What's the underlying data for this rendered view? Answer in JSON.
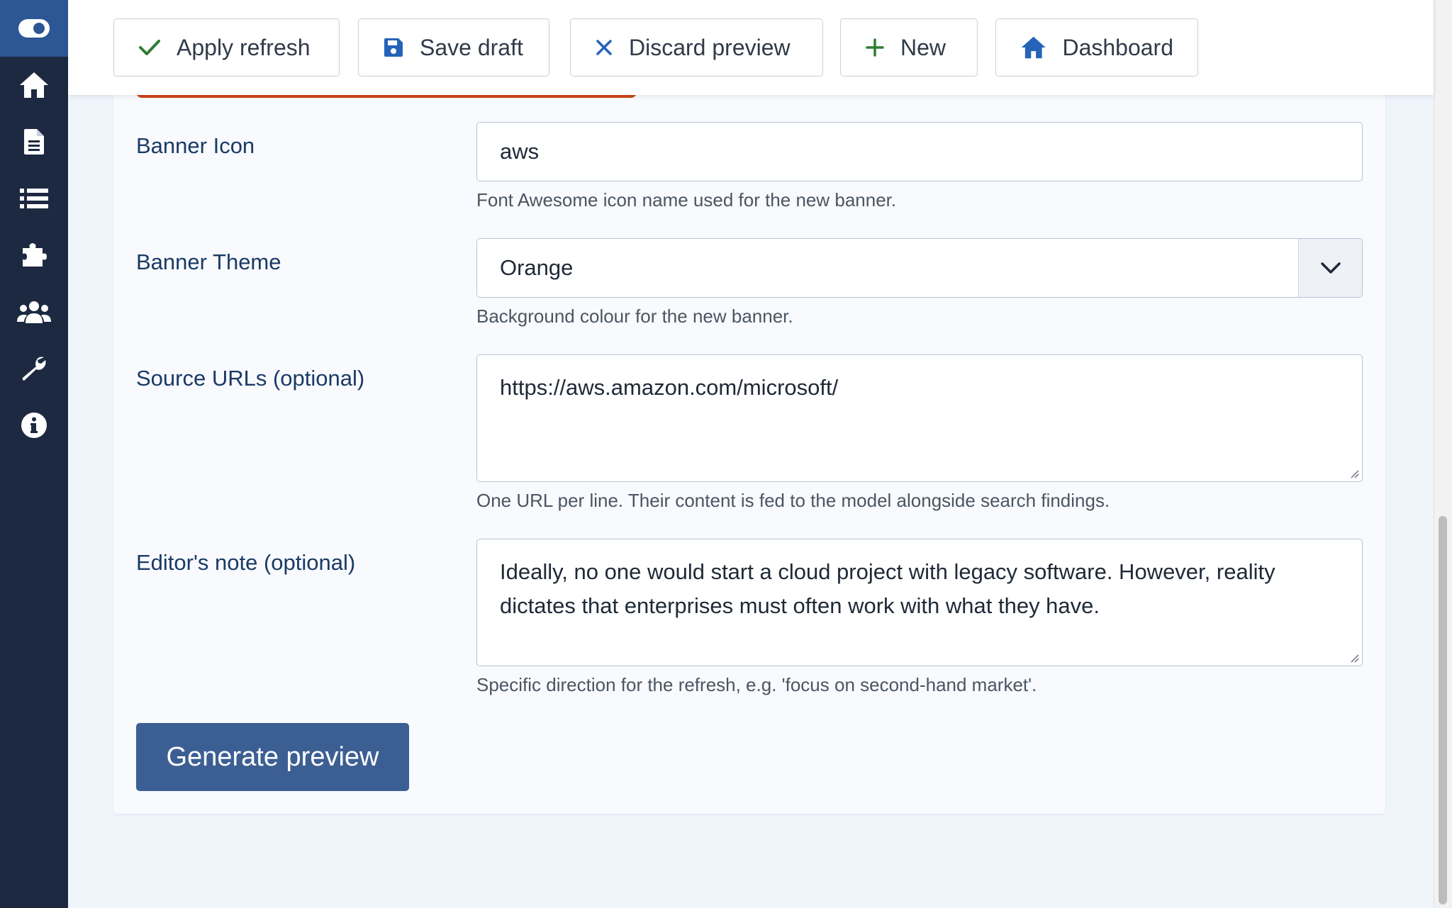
{
  "toolbar": {
    "apply_label": "Apply refresh",
    "save_label": "Save draft",
    "discard_label": "Discard preview",
    "new_label": "New",
    "dashboard_label": "Dashboard"
  },
  "form": {
    "banner_icon": {
      "label": "Banner Icon",
      "value": "aws",
      "hint": "Font Awesome icon name used for the new banner."
    },
    "banner_theme": {
      "label": "Banner Theme",
      "value": "Orange",
      "hint": "Background colour for the new banner."
    },
    "source_urls": {
      "label": "Source URLs (optional)",
      "value": "https://aws.amazon.com/microsoft/",
      "hint": "One URL per line. Their content is fed to the model alongside search findings."
    },
    "editors_note": {
      "label": "Editor's note (optional)",
      "value": "Ideally, no one would start a cloud project with legacy software. However, reality dictates that enterprises must often work with what they have.",
      "hint": "Specific direction for the refresh, e.g. 'focus on second-hand market'."
    },
    "generate_label": "Generate preview"
  },
  "sidebar": {
    "items": [
      "toggle-icon",
      "home-icon",
      "file-icon",
      "list-icon",
      "puzzle-icon",
      "users-icon",
      "wrench-icon",
      "info-icon"
    ]
  },
  "colors": {
    "sidebar_bg": "#1c2941",
    "sidebar_active": "#2d5694",
    "primary": "#3c5f93",
    "accent_red": "#cf4412",
    "check_green": "#2e7d32",
    "icon_blue": "#2563b8"
  }
}
